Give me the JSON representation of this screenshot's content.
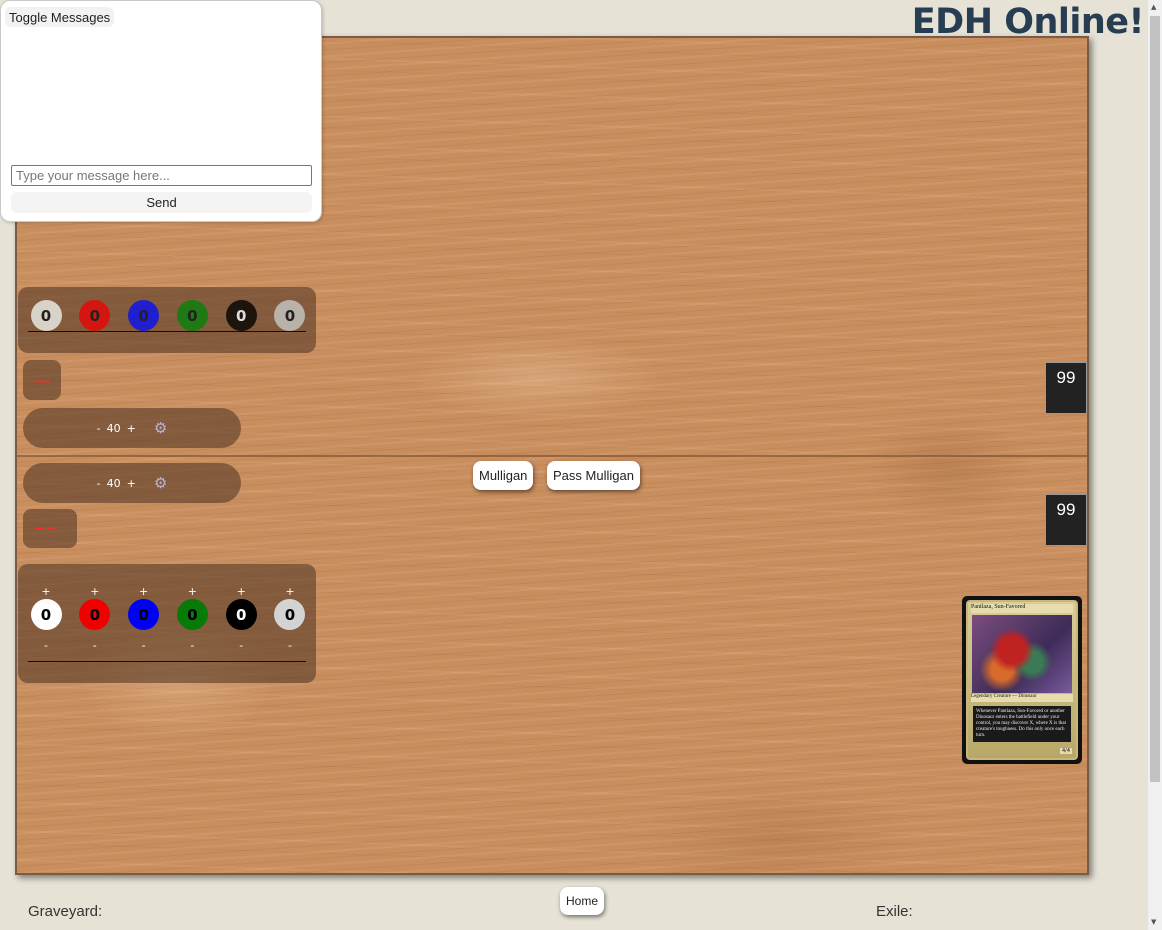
{
  "header": {
    "title": "EDH Online!"
  },
  "chat": {
    "toggle_label": "Toggle Messages",
    "input_placeholder": "Type your message here...",
    "send_label": "Send"
  },
  "opponent": {
    "mana": [
      {
        "value": "0",
        "color": "#d9d2c8"
      },
      {
        "value": "0",
        "color": "#d3160f"
      },
      {
        "value": "0",
        "color": "#1f1fd0"
      },
      {
        "value": "0",
        "color": "#1f7a14"
      },
      {
        "value": "0",
        "color": "#1e140e"
      },
      {
        "value": "0",
        "color": "#b9b2aa"
      }
    ],
    "counter_marks": "----",
    "life": {
      "minus": "-",
      "value": "40",
      "plus": "+",
      "settings_icon": "gear-icon"
    },
    "library_count": "99"
  },
  "player": {
    "life": {
      "minus": "-",
      "value": "40",
      "plus": "+",
      "settings_icon": "gear-icon"
    },
    "counter_marks": "-- --",
    "mana": [
      {
        "plus": "+",
        "value": "0",
        "minus": "-",
        "color": "#ffffff"
      },
      {
        "plus": "+",
        "value": "0",
        "minus": "-",
        "color": "#f00000"
      },
      {
        "plus": "+",
        "value": "0",
        "minus": "-",
        "color": "#0000f5"
      },
      {
        "plus": "+",
        "value": "0",
        "minus": "-",
        "color": "#087a08"
      },
      {
        "plus": "+",
        "value": "0",
        "minus": "-",
        "color": "#000000"
      },
      {
        "plus": "+",
        "value": "0",
        "minus": "-",
        "color": "#d3d3d3"
      }
    ],
    "library_count": "99",
    "commander_card": {
      "name": "Pantlaza, Sun-Favored",
      "type_line": "Legendary Creature — Dinosaur",
      "rules_text": "Whenever Pantlaza, Sun-Favored or another Dinosaur enters the battlefield under your control, you may discover X, where X is that creature's toughness. Do this only once each turn.",
      "power_toughness": "4/4"
    }
  },
  "actions": {
    "mulligan": "Mulligan",
    "pass_mulligan": "Pass Mulligan"
  },
  "footer": {
    "home": "Home",
    "graveyard": "Graveyard:",
    "exile": "Exile:"
  }
}
